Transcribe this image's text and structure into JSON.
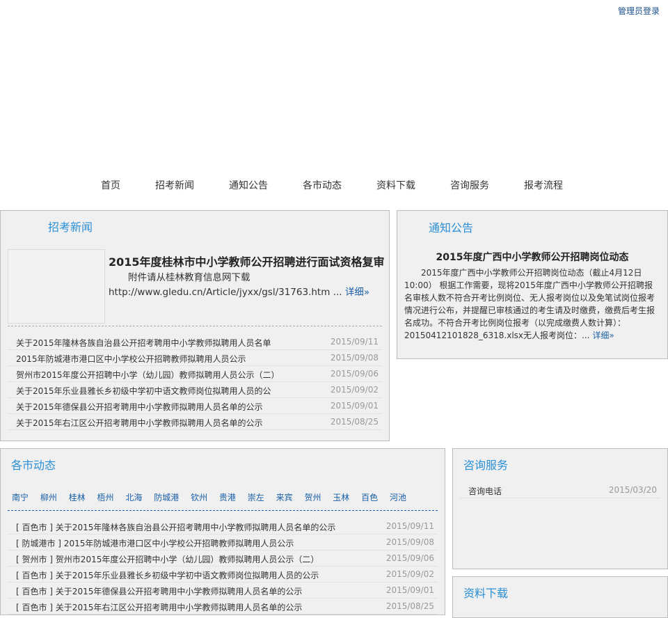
{
  "header": {
    "admin_login": "管理员登录"
  },
  "nav": {
    "items": [
      "首页",
      "招考新闻",
      "通知公告",
      "各市动态",
      "资料下载",
      "咨询服务",
      "报考流程"
    ]
  },
  "news": {
    "title": "招考新闻",
    "featured": {
      "title": "2015年度桂林市中小学教师公开招聘进行面试资格复审",
      "body_line1": "附件请从桂林教育信息网下载",
      "body_line2": "http://www.gledu.cn/Article/jyxx/gsl/31763.htm ...",
      "more": "详细»"
    },
    "items": [
      {
        "title": "关于2015年隆林各族自治县公开招考聘用中小学教师拟聘用人员名单",
        "date": "2015/09/11"
      },
      {
        "title": "2015年防城港市港口区中小学校公开招聘教师拟聘用人员公示",
        "date": "2015/09/08"
      },
      {
        "title": "贺州市2015年度公开招聘中小学（幼儿园）教师拟聘用人员公示（二）",
        "date": "2015/09/06"
      },
      {
        "title": "关于2015年乐业县雅长乡初级中学初中语文教师岗位拟聘用人员的公",
        "date": "2015/09/02"
      },
      {
        "title": "关于2015年德保县公开招考聘用中小学教师拟聘用人员名单的公示",
        "date": "2015/09/01"
      },
      {
        "title": "关于2015年右江区公开招考聘用中小学教师拟聘用人员名单的公示",
        "date": "2015/08/25"
      }
    ]
  },
  "notice": {
    "title": "通知公告",
    "item_title": "2015年度广西中小学教师公开招聘岗位动态",
    "body": "2015年度广西中小学教师公开招聘岗位动态（截止4月12日10:00） 根据工作需要，现将2015年度广西中小学教师公开招聘报名审核人数不符合开考比例岗位、无人报考岗位以及免笔试岗位报考情况进行公布，并提醒已审核通过的考生请及时缴费，缴费后考生报名成功。不符合开考比例岗位报考（以完成缴费人数计算）：20150412101828_6318.xlsx无人报考岗位：...",
    "more": "详细»"
  },
  "cities": {
    "title": "各市动态",
    "names": [
      "南宁",
      "柳州",
      "桂林",
      "梧州",
      "北海",
      "防城港",
      "钦州",
      "贵港",
      "崇左",
      "来宾",
      "贺州",
      "玉林",
      "百色",
      "河池"
    ],
    "items": [
      {
        "title": "[ 百色市 ] 关于2015年隆林各族自治县公开招考聘用中小学教师拟聘用人员名单的公示",
        "date": "2015/09/11"
      },
      {
        "title": "[ 防城港市 ] 2015年防城港市港口区中小学校公开招聘教师拟聘用人员公示",
        "date": "2015/09/08"
      },
      {
        "title": "[ 贺州市 ] 贺州市2015年度公开招聘中小学（幼儿园）教师拟聘用人员公示（二）",
        "date": "2015/09/06"
      },
      {
        "title": "[ 百色市 ] 关于2015年乐业县雅长乡初级中学初中语文教师岗位拟聘用人员的公示",
        "date": "2015/09/02"
      },
      {
        "title": "[ 百色市 ] 关于2015年德保县公开招考聘用中小学教师拟聘用人员名单的公示",
        "date": "2015/09/01"
      },
      {
        "title": "[ 百色市 ] 关于2015年右江区公开招考聘用中小学教师拟聘用人员名单的公示",
        "date": "2015/08/25"
      }
    ]
  },
  "consult": {
    "title": "咨询服务",
    "items": [
      {
        "title": "咨询电话",
        "date": "2015/03/20"
      }
    ]
  },
  "download": {
    "title": "资料下载"
  }
}
